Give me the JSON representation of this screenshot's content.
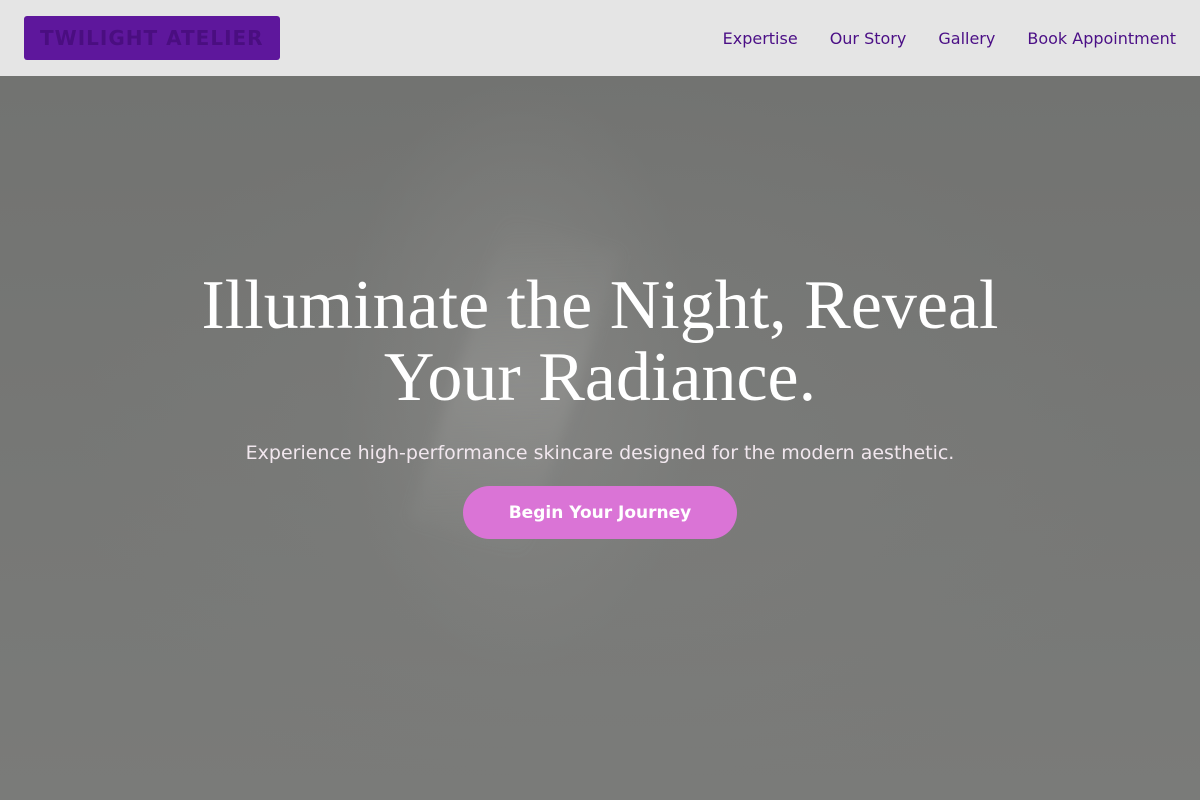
{
  "brand": {
    "logo_text": "TWILIGHT ATELIER"
  },
  "nav": {
    "items": [
      {
        "label": "Expertise"
      },
      {
        "label": "Our Story"
      },
      {
        "label": "Gallery"
      },
      {
        "label": "Book Appointment"
      }
    ]
  },
  "hero": {
    "title_line1": "Illuminate the Night, Reveal",
    "title_line2": "Your Radiance.",
    "subtitle": "Experience high-performance skincare designed for the modern aesthetic.",
    "cta_label": "Begin Your Journey"
  },
  "colors": {
    "nav_background": "#e5e5e5",
    "logo_background": "#5e179c",
    "nav_link": "#4b0f86",
    "hero_overlay": "#757674",
    "cta_background": "#da74d6"
  }
}
